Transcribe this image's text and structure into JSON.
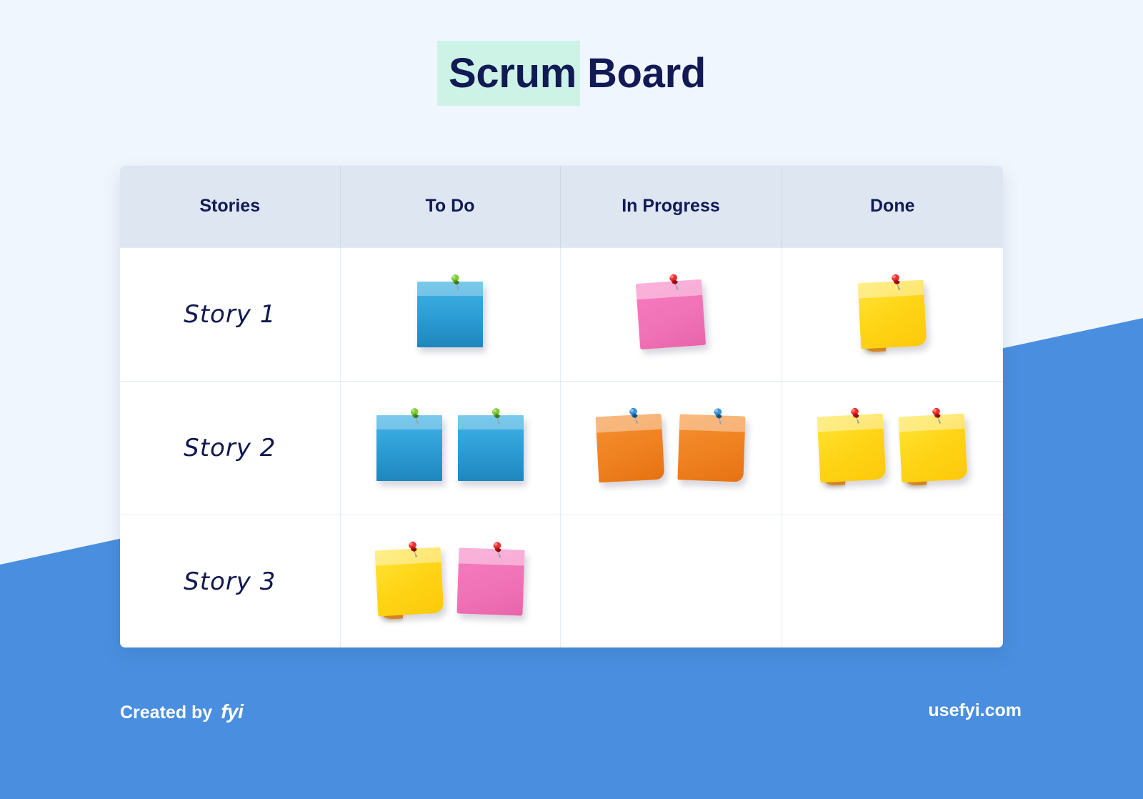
{
  "page": {
    "background_color": "#f0f6fd",
    "band_color": "#4a8fdf"
  },
  "title": {
    "highlight_text": "Scrum",
    "rest_text": "Board",
    "highlight_color": "#cdf3e6",
    "text_color": "#111a54"
  },
  "board": {
    "columns": [
      "Stories",
      "To Do",
      "In Progress",
      "Done"
    ],
    "header_bg": "#dee6f2",
    "rows": [
      {
        "story": "Story 1",
        "cells": [
          {
            "column": "To Do",
            "notes": [
              {
                "color": "blue",
                "pin": "green",
                "rotation": 0
              }
            ]
          },
          {
            "column": "In Progress",
            "notes": [
              {
                "color": "pink",
                "pin": "red",
                "rotation": -4
              }
            ]
          },
          {
            "column": "Done",
            "notes": [
              {
                "color": "yellow",
                "pin": "red",
                "rotation": -3
              }
            ]
          }
        ]
      },
      {
        "story": "Story 2",
        "cells": [
          {
            "column": "To Do",
            "notes": [
              {
                "color": "blue",
                "pin": "green",
                "rotation": 0
              },
              {
                "color": "blue",
                "pin": "green",
                "rotation": 0
              }
            ]
          },
          {
            "column": "In Progress",
            "notes": [
              {
                "color": "orange",
                "pin": "blue",
                "rotation": -3
              },
              {
                "color": "orange",
                "pin": "blue",
                "rotation": 2
              }
            ]
          },
          {
            "column": "Done",
            "notes": [
              {
                "color": "yellow",
                "pin": "red",
                "rotation": -3
              },
              {
                "color": "yellow",
                "pin": "red",
                "rotation": -3
              }
            ]
          }
        ]
      },
      {
        "story": "Story 3",
        "cells": [
          {
            "column": "To Do",
            "notes": [
              {
                "color": "yellow",
                "pin": "red",
                "rotation": -3
              },
              {
                "color": "pink",
                "pin": "red",
                "rotation": 2
              }
            ]
          },
          {
            "column": "In Progress",
            "notes": []
          },
          {
            "column": "Done",
            "notes": []
          }
        ]
      }
    ]
  },
  "footer": {
    "created_by_label": "Created by",
    "brand": "fyi",
    "website": "usefyi.com"
  },
  "note_colors": {
    "blue": "#2c9cd4",
    "pink": "#f072b6",
    "yellow": "#ffd517",
    "orange": "#ef8120"
  },
  "pin_colors": {
    "green": "#6cc22c",
    "red": "#e01b1b",
    "blue": "#2176b8"
  }
}
